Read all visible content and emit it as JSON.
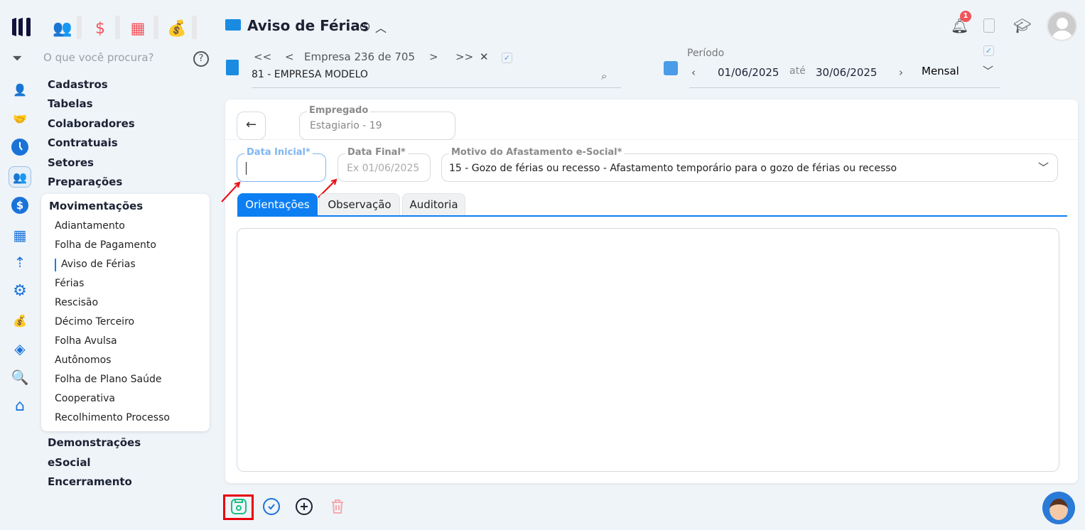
{
  "topbar": {
    "icons": [
      "people-icon",
      "dollar-icon",
      "calculator-icon",
      "money-bag-icon"
    ]
  },
  "search": {
    "placeholder": "O que você procura?",
    "help": "?"
  },
  "menu": {
    "items": [
      "Cadastros",
      "Tabelas",
      "Colaboradores",
      "Contratuais",
      "Setores",
      "Preparações"
    ],
    "submenu_title": "Movimentações",
    "submenu": [
      "Adiantamento",
      "Folha de Pagamento",
      "Aviso de Férias",
      "Férias",
      "Rescisão",
      "Décimo Terceiro",
      "Folha Avulsa",
      "Autônomos",
      "Folha de Plano Saúde",
      "Cooperativa",
      "Recolhimento Processo"
    ],
    "active": "Aviso de Férias",
    "after": [
      "Demonstrações",
      "eSocial",
      "Encerramento"
    ]
  },
  "header": {
    "title": "Aviso de Férias",
    "notification_count": "1"
  },
  "empresa": {
    "nav": "Empresa 236 de 705",
    "value": "81 - EMPRESA MODELO",
    "first": "<<",
    "prev": "<",
    "next": ">",
    "last": ">>",
    "clear": "✕"
  },
  "periodo": {
    "label": "Período",
    "from": "01/06/2025",
    "sep": "até",
    "to": "30/06/2025",
    "type": "Mensal"
  },
  "form": {
    "empregado_label": "Empregado",
    "empregado_value": "Estagiario - 19",
    "data_inicial_label": "Data Inicial*",
    "data_inicial_value": "",
    "data_final_label": "Data Final*",
    "data_final_placeholder": "Ex 01/06/2025",
    "motivo_label": "Motivo do Afastamento e-Social*",
    "motivo_value": "15 - Gozo de férias ou recesso - Afastamento temporário para o gozo de férias ou recesso"
  },
  "tabs": [
    "Orientações",
    "Observação",
    "Auditoria"
  ],
  "colors": {
    "accent": "#0d7ff2",
    "danger": "#f2545b",
    "save": "#1dbf84"
  }
}
